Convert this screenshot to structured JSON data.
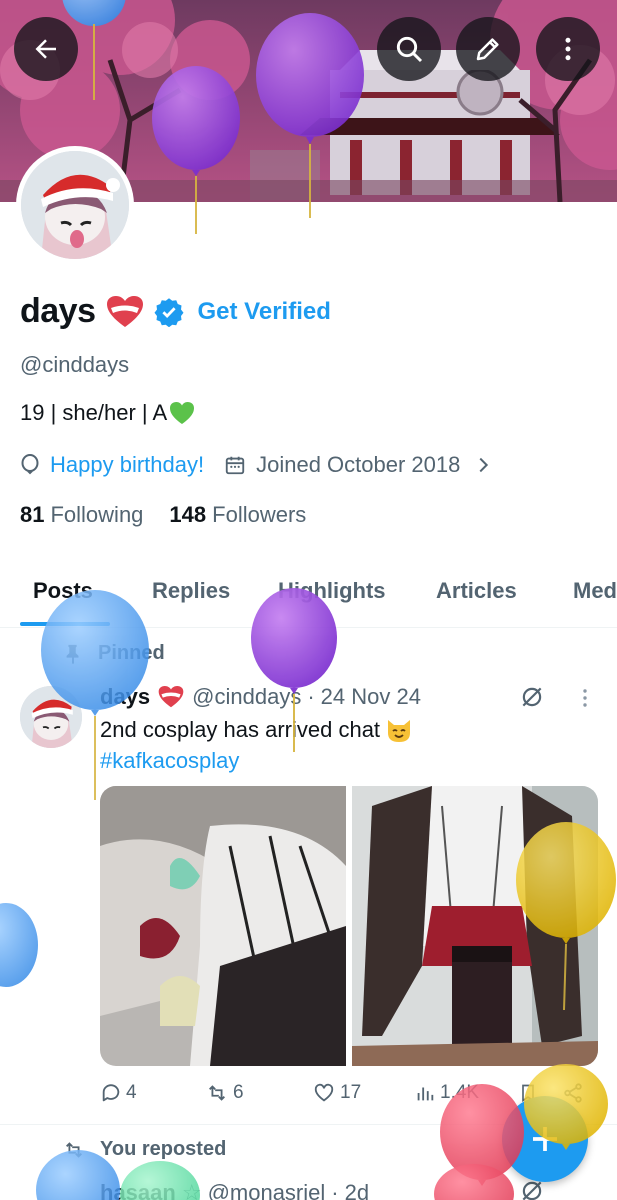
{
  "profile": {
    "display_name": "days",
    "get_verified_label": "Get Verified",
    "handle": "@cinddays",
    "bio": "19 | she/her | A",
    "birthday_text": "Happy birthday!",
    "joined_text": "Joined October 2018",
    "following_count": "81",
    "following_label": "Following",
    "followers_count": "148",
    "followers_label": "Followers"
  },
  "tabs": [
    {
      "label": "Posts",
      "active": true
    },
    {
      "label": "Replies"
    },
    {
      "label": "Highlights"
    },
    {
      "label": "Articles"
    },
    {
      "label": "Media"
    }
  ],
  "pinned_tweet": {
    "pinned_label": "Pinned",
    "author_name": "days",
    "author_handle": "@cinddays",
    "separator": "·",
    "date": "24 Nov 24",
    "text": "2nd cosplay has arrived chat",
    "hashtag": "#kafkacosplay",
    "replies": "4",
    "reposts": "6",
    "likes": "17",
    "views": "1.4K"
  },
  "reposted_tweet": {
    "repost_label": "You reposted",
    "author_name": "hasaan",
    "author_handle": "@monasriel",
    "separator": "·",
    "date": "2d"
  },
  "colors": {
    "accent": "#1d9bf0",
    "text_primary": "#0f1419",
    "text_secondary": "#536471"
  },
  "icons": [
    "back-arrow-icon",
    "search-icon",
    "edit-icon",
    "more-vertical-icon",
    "verified-badge-icon",
    "heart-emoji-icon",
    "green-heart-emoji-icon",
    "balloon-icon",
    "calendar-icon",
    "chevron-right-icon",
    "pin-icon",
    "grok-icon",
    "reply-icon",
    "repost-icon",
    "like-icon",
    "views-icon",
    "bookmark-icon",
    "share-icon",
    "plus-icon",
    "cat-emoji-icon"
  ]
}
